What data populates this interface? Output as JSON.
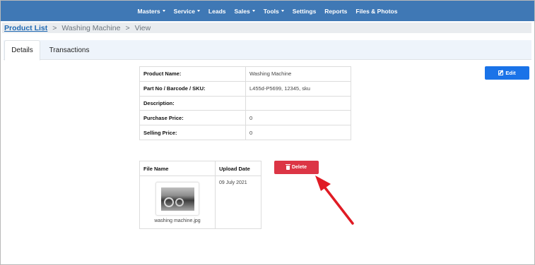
{
  "nav": {
    "items": [
      {
        "label": "Masters",
        "has_caret": true
      },
      {
        "label": "Service",
        "has_caret": true
      },
      {
        "label": "Leads",
        "has_caret": false
      },
      {
        "label": "Sales",
        "has_caret": true
      },
      {
        "label": "Tools",
        "has_caret": true
      },
      {
        "label": "Settings",
        "has_caret": false
      },
      {
        "label": "Reports",
        "has_caret": false
      },
      {
        "label": "Files & Photos",
        "has_caret": false
      }
    ]
  },
  "breadcrumb": {
    "link": "Product List",
    "separator": ">",
    "item": "Washing Machine",
    "current": "View"
  },
  "tabs": {
    "details": "Details",
    "transactions": "Transactions"
  },
  "product": {
    "rows": [
      {
        "label": "Product Name:",
        "value": "Washing Machine"
      },
      {
        "label": "Part No / Barcode / SKU:",
        "value": "L455d-P5699, 12345, sku"
      },
      {
        "label": "Description:",
        "value": ""
      },
      {
        "label": "Purchase Price:",
        "value": "0"
      },
      {
        "label": "Selling Price:",
        "value": "0"
      }
    ]
  },
  "actions": {
    "edit_label": "Edit",
    "delete_label": "Delete"
  },
  "files": {
    "headers": {
      "file_name": "File Name",
      "upload_date": "Upload Date"
    },
    "rows": [
      {
        "file_name": "washing machine.jpg",
        "upload_date": "09 July 2021"
      }
    ]
  },
  "colors": {
    "nav_bg": "#3f78b5",
    "edit_button": "#1a73e8",
    "delete_button": "#dc3545",
    "arrow": "#e01b24"
  },
  "icons": {
    "edit": "edit-icon",
    "delete": "trash-icon",
    "caret": "caret-down-icon"
  }
}
